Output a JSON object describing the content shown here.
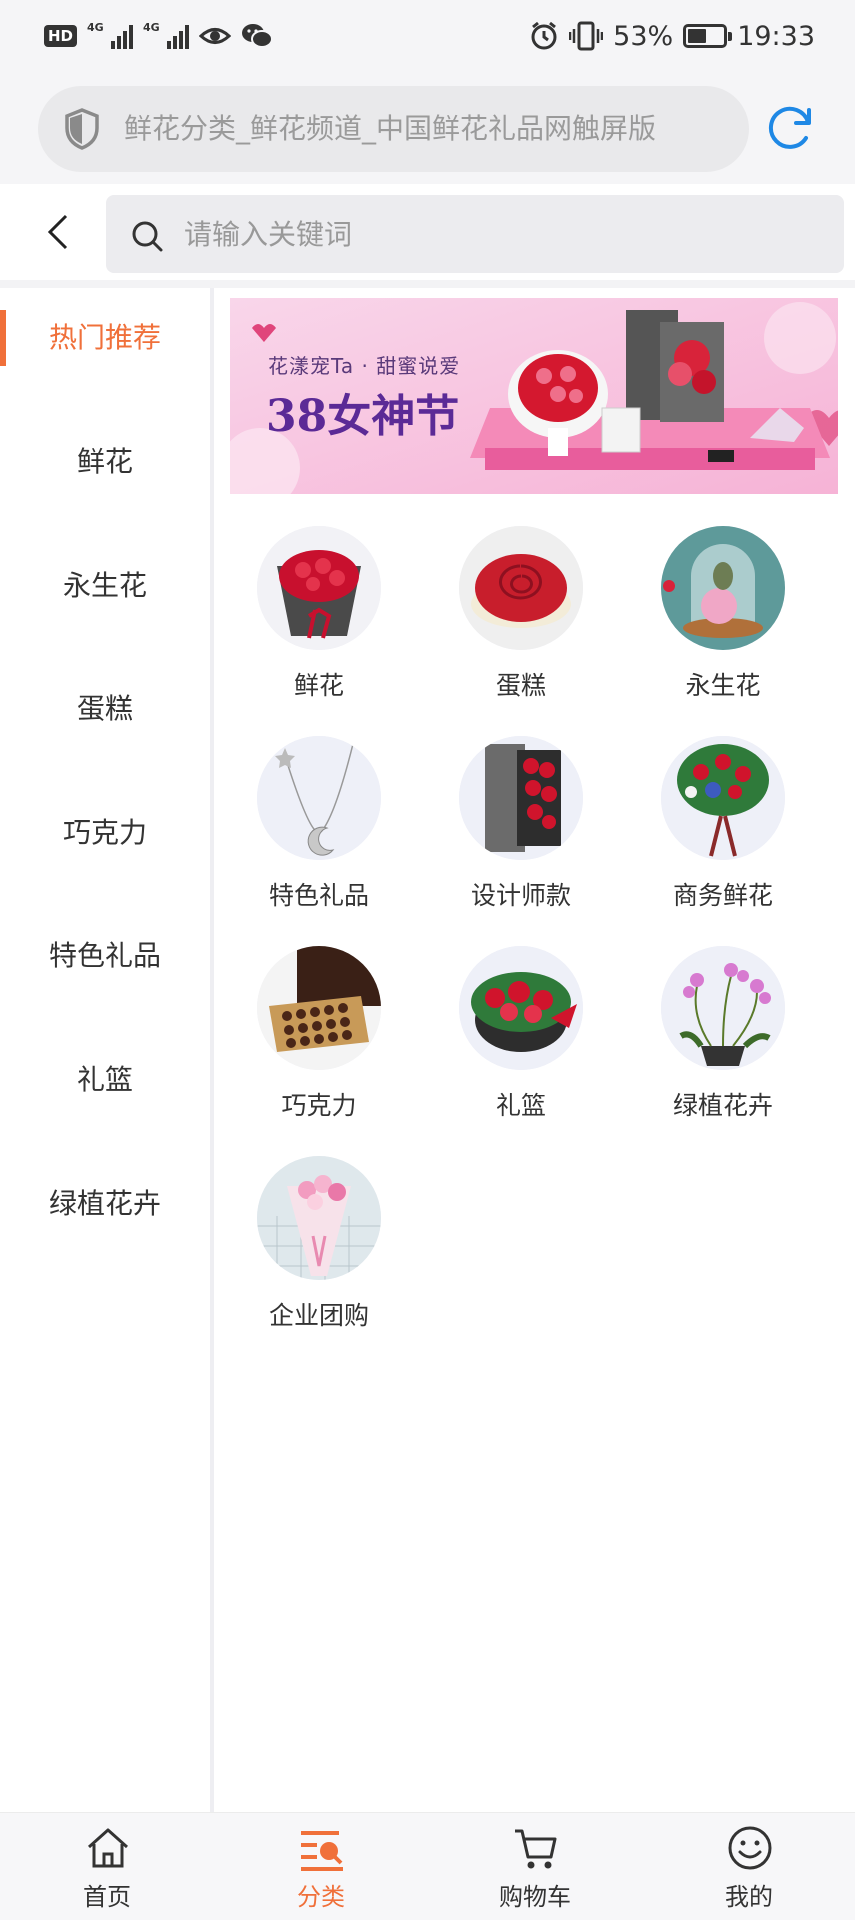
{
  "status_bar": {
    "hd": "HD",
    "sim1": "4G",
    "sim2": "4G",
    "battery": "53%",
    "battery_level": 0.53,
    "time": "19:33"
  },
  "browser": {
    "url_title": "鲜花分类_鲜花频道_中国鲜花礼品网触屏版"
  },
  "search": {
    "placeholder": "请输入关键词"
  },
  "sidebar": {
    "items": [
      {
        "label": "热门推荐",
        "active": true
      },
      {
        "label": "鲜花"
      },
      {
        "label": "永生花"
      },
      {
        "label": "蛋糕"
      },
      {
        "label": "巧克力"
      },
      {
        "label": "特色礼品"
      },
      {
        "label": "礼篮"
      },
      {
        "label": "绿植花卉"
      }
    ]
  },
  "banner": {
    "subtitle": "花漾宠Ta · 甜蜜说爱",
    "title": "38女神节"
  },
  "categories": [
    {
      "label": "鲜花",
      "icon": "flower-bouquet-thumb"
    },
    {
      "label": "蛋糕",
      "icon": "cake-thumb"
    },
    {
      "label": "永生花",
      "icon": "preserved-flower-thumb"
    },
    {
      "label": "特色礼品",
      "icon": "necklace-thumb"
    },
    {
      "label": "设计师款",
      "icon": "designer-box-thumb"
    },
    {
      "label": "商务鲜花",
      "icon": "business-basket-thumb"
    },
    {
      "label": "巧克力",
      "icon": "chocolate-box-thumb"
    },
    {
      "label": "礼篮",
      "icon": "gift-basket-thumb"
    },
    {
      "label": "绿植花卉",
      "icon": "orchid-plant-thumb"
    },
    {
      "label": "企业团购",
      "icon": "group-bouquet-thumb"
    }
  ],
  "tabs": [
    {
      "label": "首页",
      "icon": "home-icon"
    },
    {
      "label": "分类",
      "icon": "category-icon",
      "active": true
    },
    {
      "label": "购物车",
      "icon": "cart-icon"
    },
    {
      "label": "我的",
      "icon": "smiley-icon"
    }
  ],
  "colors": {
    "accent": "#f0703a",
    "refresh": "#1e88e5"
  }
}
